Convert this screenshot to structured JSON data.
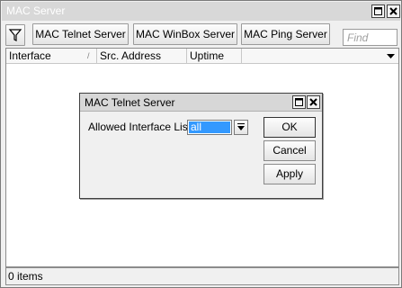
{
  "window": {
    "title": "MAC Server"
  },
  "toolbar": {
    "filter_icon": "filter-icon",
    "buttons": [
      "MAC Telnet Server",
      "MAC WinBox Server",
      "MAC Ping Server"
    ],
    "find_placeholder": "Find"
  },
  "table": {
    "columns": [
      "Interface",
      "Src. Address",
      "Uptime"
    ],
    "sort_indicator": "/",
    "rows": []
  },
  "status": {
    "count_text": "0 items"
  },
  "dialog": {
    "title": "MAC Telnet Server",
    "field_label": "Allowed Interface List:",
    "field_value": "all",
    "buttons": {
      "ok": "OK",
      "cancel": "Cancel",
      "apply": "Apply"
    }
  },
  "colors": {
    "selection": "#3399ff",
    "titlebar": "#d8d8d8"
  }
}
